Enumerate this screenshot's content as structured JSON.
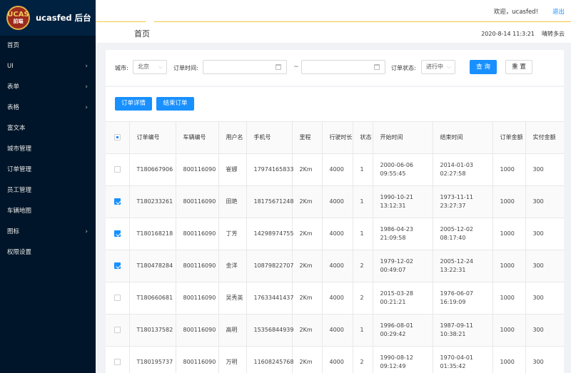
{
  "app": {
    "logo_top": "UCAS",
    "logo_bottom": "前端",
    "title": "ucasfed 后台"
  },
  "sidebar": {
    "items": [
      {
        "label": "首页",
        "has_arrow": false
      },
      {
        "label": "UI",
        "has_arrow": true
      },
      {
        "label": "表单",
        "has_arrow": true
      },
      {
        "label": "表格",
        "has_arrow": true
      },
      {
        "label": "富文本",
        "has_arrow": false
      },
      {
        "label": "城市管理",
        "has_arrow": false
      },
      {
        "label": "订单管理",
        "has_arrow": false
      },
      {
        "label": "员工管理",
        "has_arrow": false
      },
      {
        "label": "车辆地图",
        "has_arrow": false
      },
      {
        "label": "图标",
        "has_arrow": true
      },
      {
        "label": "权限设置",
        "has_arrow": false
      }
    ],
    "arrow_glyph": "›"
  },
  "header": {
    "welcome": "欢迎，ucasfed!",
    "logout": "退出"
  },
  "breadcrumb": {
    "title": "首页",
    "datetime": "2020-8-14 11:3:21",
    "weather": "晴转多云"
  },
  "filter": {
    "city_label": "城市:",
    "city_value": "北京",
    "order_time_label": "订单时间:",
    "range_separator": "~",
    "status_label": "订单状态:",
    "status_value": "进行中",
    "query_button": "查 询",
    "reset_button": "重 置",
    "chevron": "⌵"
  },
  "actions": {
    "detail_button": "订单详情",
    "finish_button": "结束订单"
  },
  "table": {
    "columns": [
      "订单编号",
      "车辆编号",
      "用户名",
      "手机号",
      "里程",
      "行驶时长",
      "状态",
      "开始时间",
      "结束时间",
      "订单金额",
      "实付金额"
    ],
    "header_checkbox": "partial",
    "rows": [
      {
        "checked": false,
        "order_no": "T180667906",
        "car_no": "800116090",
        "user": "崔娜",
        "phone": "17974165833",
        "distance": "2Km",
        "duration": "4000",
        "status": "1",
        "start": "2000-06-06 09:55:45",
        "end": "2014-01-03 02:27:58",
        "amount": "1000",
        "paid": "300"
      },
      {
        "checked": true,
        "order_no": "T180233261",
        "car_no": "800116090",
        "user": "田艳",
        "phone": "18175671248",
        "distance": "2Km",
        "duration": "4000",
        "status": "1",
        "start": "1990-10-21 13:12:31",
        "end": "1973-11-11 23:27:37",
        "amount": "1000",
        "paid": "300"
      },
      {
        "checked": true,
        "order_no": "T180168218",
        "car_no": "800116090",
        "user": "丁芳",
        "phone": "14298974755",
        "distance": "2Km",
        "duration": "4000",
        "status": "1",
        "start": "1986-04-23 21:09:58",
        "end": "2005-12-02 08:17:40",
        "amount": "1000",
        "paid": "300"
      },
      {
        "checked": true,
        "order_no": "T180478284",
        "car_no": "800116090",
        "user": "金洋",
        "phone": "10879822707",
        "distance": "2Km",
        "duration": "4000",
        "status": "2",
        "start": "1979-12-02 00:49:07",
        "end": "2005-12-24 13:22:31",
        "amount": "1000",
        "paid": "300"
      },
      {
        "checked": false,
        "order_no": "T180660681",
        "car_no": "800116090",
        "user": "吴秀英",
        "phone": "17633441437",
        "distance": "2Km",
        "duration": "4000",
        "status": "2",
        "start": "2015-03-28 00:21:21",
        "end": "1976-06-07 16:19:09",
        "amount": "1000",
        "paid": "300"
      },
      {
        "checked": false,
        "order_no": "T180137582",
        "car_no": "800116090",
        "user": "高明",
        "phone": "15356844939",
        "distance": "2Km",
        "duration": "4000",
        "status": "1",
        "start": "1996-08-01 00:29:42",
        "end": "1987-09-11 10:38:21",
        "amount": "1000",
        "paid": "300"
      },
      {
        "checked": false,
        "order_no": "T180195737",
        "car_no": "800116090",
        "user": "万明",
        "phone": "11608245768",
        "distance": "2Km",
        "duration": "4000",
        "status": "2",
        "start": "1990-08-12 09:12:49",
        "end": "1970-04-01 01:35:42",
        "amount": "1000",
        "paid": "300"
      }
    ]
  },
  "colors": {
    "sidebar_bg": "#001529",
    "logo_bg": "#00213f",
    "primary": "#1890ff",
    "header_accent": "#f5c842"
  }
}
